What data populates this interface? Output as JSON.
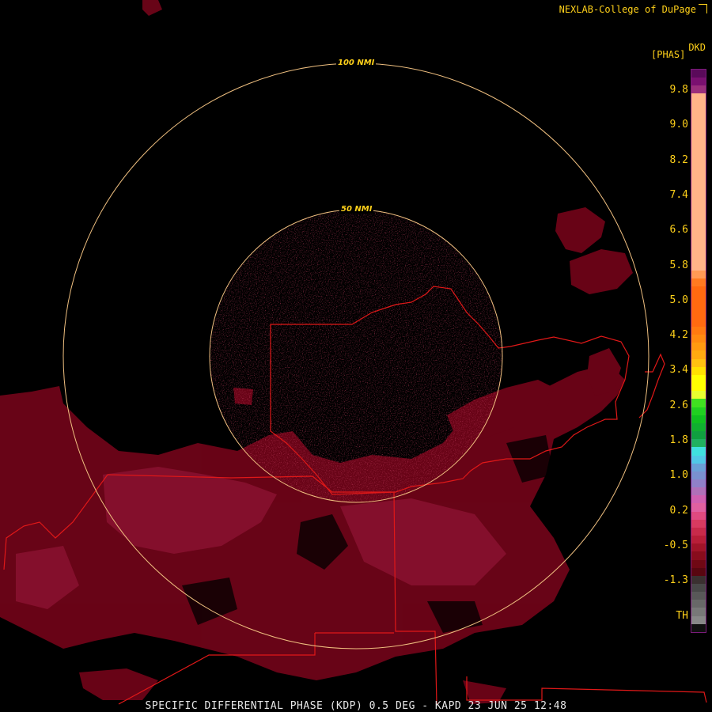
{
  "credit": "NEXLAB-College of DuPage",
  "product_code": "DKD",
  "units": "[PHAS]",
  "title": "SPECIFIC DIFFERENTIAL PHASE (KDP) 0.5 DEG - KAPD 23 JUN 25 12:48",
  "range_rings": [
    "50 NMI",
    "100 NMI"
  ],
  "colors": {
    "background": "#000000",
    "ring": "#f0c080",
    "boundary": "#e01818",
    "echo": "#6e0418",
    "label": "#ffd11a"
  },
  "legend": {
    "ticks": [
      "9.8",
      "9.0",
      "8.2",
      "7.4",
      "6.6",
      "5.8",
      "5.0",
      "4.2",
      "3.4",
      "2.6",
      "1.8",
      "1.0",
      "0.2",
      "-0.5",
      "-1.3",
      "TH"
    ],
    "swatches": [
      "#5a0a5a",
      "#7a1070",
      "#9b2f7c",
      "#ffb488",
      "#ffb488",
      "#ffb488",
      "#ffb488",
      "#ffb488",
      "#ffb488",
      "#ffb488",
      "#ffb488",
      "#ffb488",
      "#ffb488",
      "#ffb488",
      "#ffb488",
      "#ffb488",
      "#ffb488",
      "#ffb488",
      "#ffb488",
      "#ffb488",
      "#ffb488",
      "#ffb488",
      "#ffb488",
      "#ffb488",
      "#ffb488",
      "#ff9a55",
      "#ff7a20",
      "#ff6a10",
      "#ff6a10",
      "#ff6a10",
      "#ff6a10",
      "#ff6a10",
      "#ff7a10",
      "#ff8a10",
      "#ff9a10",
      "#ffaa10",
      "#ffc010",
      "#ffe000",
      "#ffff00",
      "#ffff00",
      "#e8ff30",
      "#40e020",
      "#20d020",
      "#10c020",
      "#10b030",
      "#10a040",
      "#20b060",
      "#40e0e0",
      "#50c8e8",
      "#6aa0d8",
      "#7a90d0",
      "#9080c8",
      "#b070b8",
      "#d060b0",
      "#e060a0",
      "#e04a80",
      "#d83a60",
      "#c82a4a",
      "#b81e38",
      "#a01428",
      "#880c1c",
      "#700814",
      "#580610",
      "#3a3030",
      "#484848",
      "#585858",
      "#686868",
      "#787878",
      "#888888",
      "#101010"
    ]
  }
}
